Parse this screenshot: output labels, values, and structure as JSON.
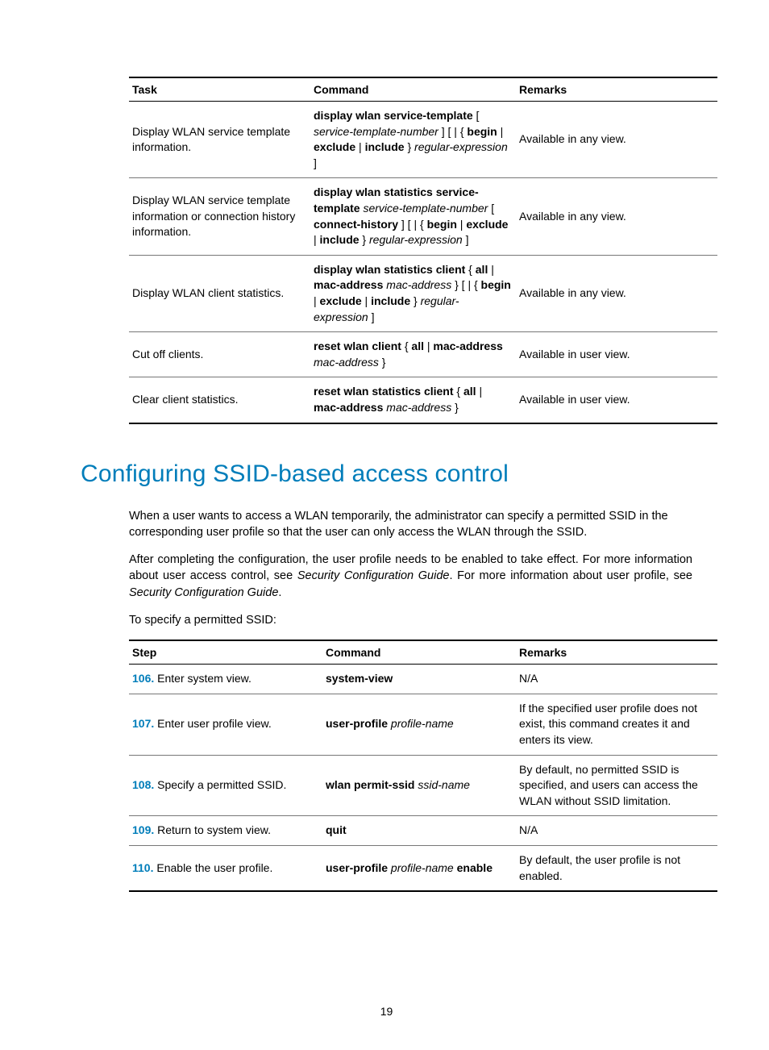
{
  "table1": {
    "headers": [
      "Task",
      "Command",
      "Remarks"
    ],
    "rows": [
      {
        "task": "Display WLAN service template information.",
        "command": [
          {
            "t": "display wlan service-template",
            "b": true
          },
          {
            "t": " [ ",
            "b": false
          },
          {
            "t": "service-template-number",
            "i": true
          },
          {
            "t": " ] [ | { ",
            "b": false
          },
          {
            "t": "begin",
            "b": true
          },
          {
            "t": " | ",
            "b": false
          },
          {
            "t": "exclude",
            "b": true
          },
          {
            "t": " | ",
            "b": false
          },
          {
            "t": "include",
            "b": true
          },
          {
            "t": " } ",
            "b": false
          },
          {
            "t": "regular-expression",
            "i": true
          },
          {
            "t": " ]",
            "b": false
          }
        ],
        "remarks": "Available in any view."
      },
      {
        "task": "Display WLAN service template information or connection history information.",
        "command": [
          {
            "t": "display wlan statistics service-template",
            "b": true
          },
          {
            "t": " ",
            "b": false
          },
          {
            "t": "service-template-number",
            "i": true
          },
          {
            "t": " [ ",
            "b": false
          },
          {
            "t": "connect-history",
            "b": true
          },
          {
            "t": " ] [ | { ",
            "b": false
          },
          {
            "t": "begin",
            "b": true
          },
          {
            "t": " | ",
            "b": false
          },
          {
            "t": "exclude",
            "b": true
          },
          {
            "t": " | ",
            "b": false
          },
          {
            "t": "include",
            "b": true
          },
          {
            "t": " } ",
            "b": false
          },
          {
            "t": "regular-expression",
            "i": true
          },
          {
            "t": " ]",
            "b": false
          }
        ],
        "remarks": "Available in any view."
      },
      {
        "task": "Display WLAN client statistics.",
        "command": [
          {
            "t": "display wlan statistics client",
            "b": true
          },
          {
            "t": " { ",
            "b": false
          },
          {
            "t": "all",
            "b": true
          },
          {
            "t": " | ",
            "b": false
          },
          {
            "t": "mac-address",
            "b": true
          },
          {
            "t": " ",
            "b": false
          },
          {
            "t": "mac-address",
            "i": true
          },
          {
            "t": " } [ | { ",
            "b": false
          },
          {
            "t": "begin",
            "b": true
          },
          {
            "t": " | ",
            "b": false
          },
          {
            "t": "exclude",
            "b": true
          },
          {
            "t": " | ",
            "b": false
          },
          {
            "t": "include",
            "b": true
          },
          {
            "t": " } ",
            "b": false
          },
          {
            "t": "regular-expression",
            "i": true
          },
          {
            "t": " ]",
            "b": false
          }
        ],
        "remarks": "Available in any view."
      },
      {
        "task": "Cut off clients.",
        "command": [
          {
            "t": "reset wlan client",
            "b": true
          },
          {
            "t": " { ",
            "b": false
          },
          {
            "t": "all",
            "b": true
          },
          {
            "t": " | ",
            "b": false
          },
          {
            "t": "mac-address",
            "b": true
          },
          {
            "t": " ",
            "b": false
          },
          {
            "t": "mac-address",
            "i": true
          },
          {
            "t": " }",
            "b": false
          }
        ],
        "remarks": "Available in user view."
      },
      {
        "task": "Clear client statistics.",
        "command": [
          {
            "t": "reset wlan statistics client",
            "b": true
          },
          {
            "t": " { ",
            "b": false
          },
          {
            "t": "all",
            "b": true
          },
          {
            "t": " | ",
            "b": false
          },
          {
            "t": "mac-address",
            "b": true
          },
          {
            "t": " ",
            "b": false
          },
          {
            "t": "mac-address",
            "i": true
          },
          {
            "t": " }",
            "b": false
          }
        ],
        "remarks": "Available in user view."
      }
    ]
  },
  "heading": "Configuring SSID-based access control",
  "para1": "When a user wants to access a WLAN temporarily, the administrator can specify a permitted SSID in the corresponding user profile so that the user can only access the WLAN through the SSID.",
  "para2_pre": "After completing the configuration, the user profile needs to be enabled to take effect. For more information about user access control, see ",
  "para2_i1": "Security Configuration Guide",
  "para2_mid": ". For more information about user profile, see ",
  "para2_i2": "Security Configuration Guide",
  "para2_post": ".",
  "para3": "To specify a permitted SSID:",
  "table2": {
    "headers": [
      "Step",
      "Command",
      "Remarks"
    ],
    "rows": [
      {
        "num": "106.",
        "step": "Enter system view.",
        "command": [
          {
            "t": "system-view",
            "b": true
          }
        ],
        "remarks": "N/A"
      },
      {
        "num": "107.",
        "step": "Enter user profile view.",
        "command": [
          {
            "t": "user-profile",
            "b": true
          },
          {
            "t": " ",
            "b": false
          },
          {
            "t": "profile-name",
            "i": true
          }
        ],
        "remarks": "If the specified user profile does not exist, this command creates it and enters its view."
      },
      {
        "num": "108.",
        "step": "Specify a permitted SSID.",
        "command": [
          {
            "t": "wlan permit-ssid",
            "b": true
          },
          {
            "t": " ",
            "b": false
          },
          {
            "t": "ssid-name",
            "i": true
          }
        ],
        "remarks": "By default, no permitted SSID is specified, and users can access the WLAN without SSID limitation."
      },
      {
        "num": "109.",
        "step": "Return to system view.",
        "command": [
          {
            "t": "quit",
            "b": true
          }
        ],
        "remarks": "N/A"
      },
      {
        "num": "110.",
        "step": "Enable the user profile.",
        "command": [
          {
            "t": "user-profile",
            "b": true
          },
          {
            "t": " ",
            "b": false
          },
          {
            "t": "profile-name",
            "i": true
          },
          {
            "t": " ",
            "b": false
          },
          {
            "t": "enable",
            "b": true
          }
        ],
        "remarks": "By default, the user profile is not enabled."
      }
    ]
  },
  "pagenum": "19"
}
